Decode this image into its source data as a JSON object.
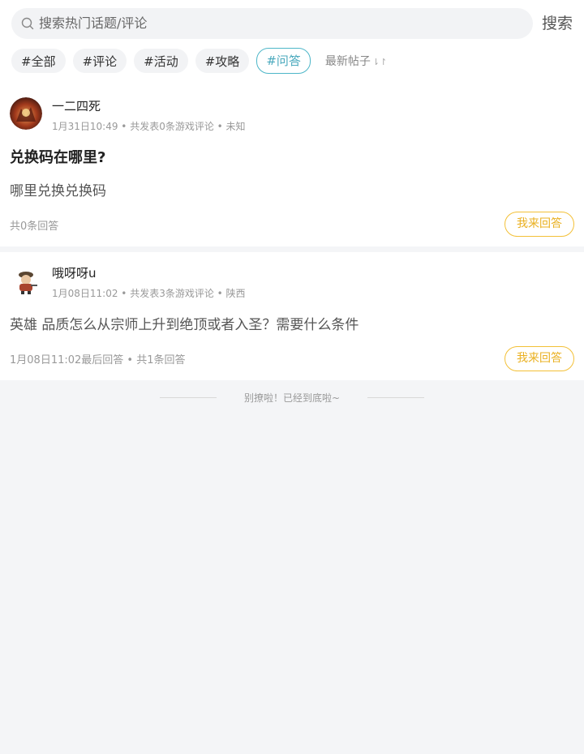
{
  "search": {
    "placeholder": "搜索热门话题/评论",
    "button_label": "搜索"
  },
  "tags": [
    {
      "label": "#全部",
      "active": false
    },
    {
      "label": "#评论",
      "active": false
    },
    {
      "label": "#活动",
      "active": false
    },
    {
      "label": "#攻略",
      "active": false
    },
    {
      "label": "#问答",
      "active": true
    }
  ],
  "sort": {
    "label": "最新帖子",
    "icon": "sort-arrows-icon"
  },
  "colors": {
    "accent": "#4db6c8",
    "answer_button": "#f3c037",
    "background": "#f4f5f7"
  },
  "posts": [
    {
      "username": "一二四死",
      "meta": "1月31日10:49 • 共发表0条游戏评论 • 未知",
      "title": "兑换码在哪里?",
      "body": "哪里兑换兑换码",
      "footer": "共0条回答",
      "answer_label": "我来回答"
    },
    {
      "username": "哦呀呀u",
      "meta": "1月08日11:02 • 共发表3条游戏评论 • 陕西",
      "title": "",
      "body": "英雄 品质怎么从宗师上升到绝顶或者入圣？需要什么条件",
      "footer": "1月08日11:02最后回答 • 共1条回答",
      "answer_label": "我来回答"
    }
  ],
  "end_text": "别撩啦！已经到底啦~"
}
